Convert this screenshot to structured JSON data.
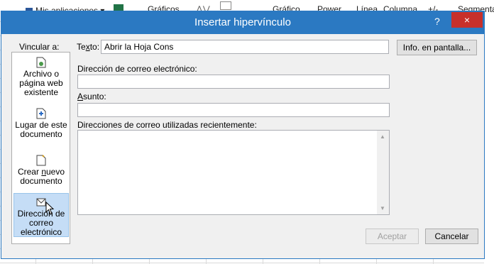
{
  "background": {
    "ribbon": [
      "Mis aplicaciones",
      "Gráficos",
      "Gráfico",
      "Power",
      "Línea",
      "Columna",
      "+/-",
      "Segmentac"
    ]
  },
  "dialog": {
    "title": "Insertar hipervínculo",
    "help_label": "?",
    "close_label": "×",
    "link_to_label": "Vincular a:",
    "text_label_pre": "Te",
    "text_label_ul": "x",
    "text_label_post": "to:",
    "text_value": "Abrir la Hoja Cons",
    "screentip_button": "Info. en pantalla...",
    "email_label": "Dirección de correo electrónico:",
    "email_value": "",
    "subject_label_ul": "A",
    "subject_label_rest": "sunto:",
    "subject_value": "",
    "recent_label": "Direcciones de correo utilizadas recientemente:",
    "ok_button": "Aceptar",
    "cancel_button": "Cancelar",
    "sidebar": [
      {
        "line1": "Archivo o",
        "line2": "página web",
        "line3": "existente",
        "icon": "file-web-icon"
      },
      {
        "line1": "Lugar de este",
        "line2": "documento",
        "line3": "",
        "icon": "place-document-icon"
      },
      {
        "line1": "Crear nuevo",
        "line2": "documento",
        "line3": "",
        "icon": "new-document-icon"
      },
      {
        "line1": "Dirección de",
        "line2": "correo",
        "line3": "electrónico",
        "icon": "email-icon"
      }
    ]
  }
}
